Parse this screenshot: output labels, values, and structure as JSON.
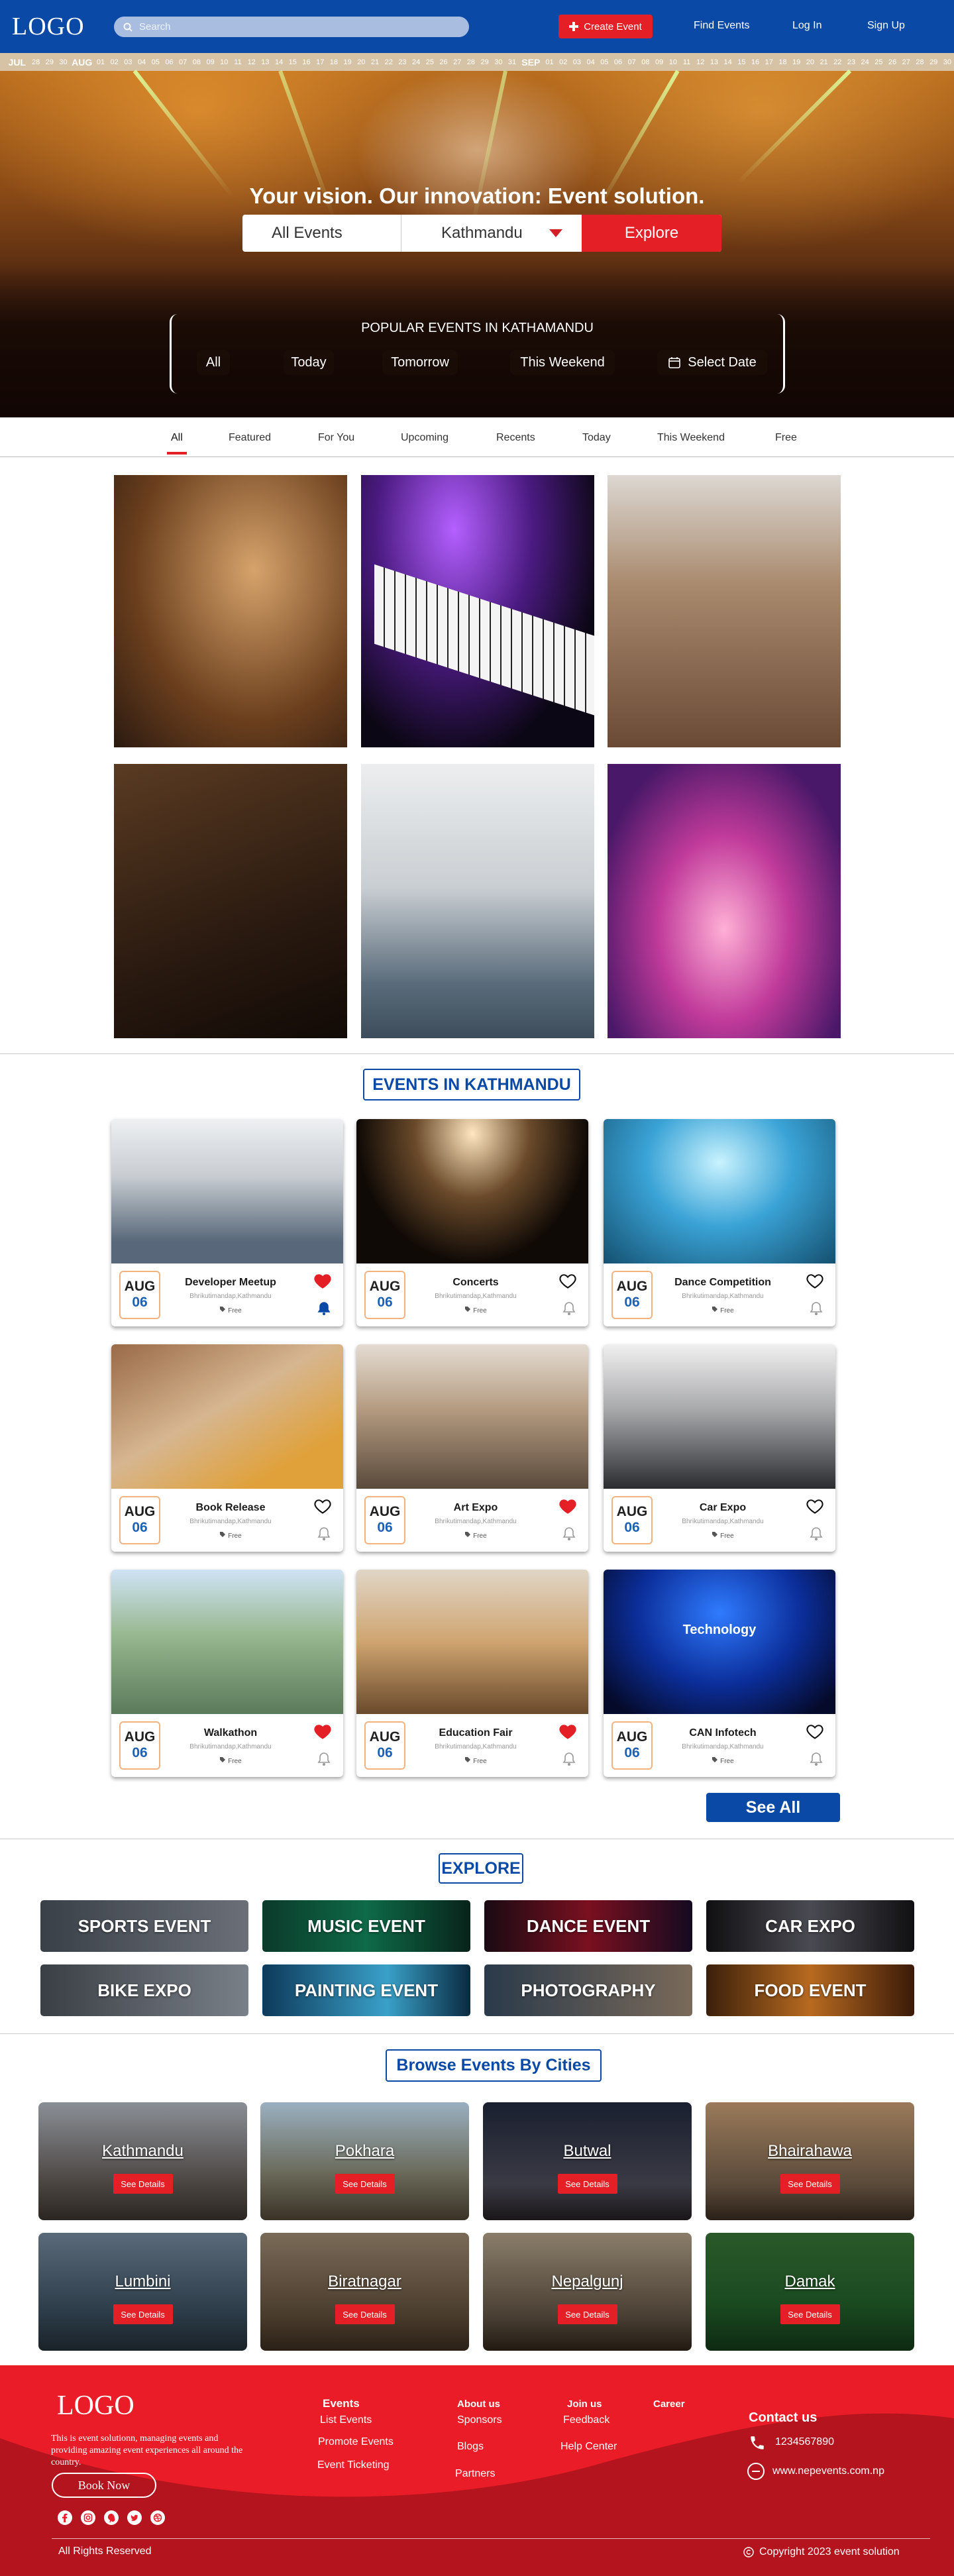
{
  "nav": {
    "logo": "LOGO",
    "search_placeholder": "Search",
    "create_event": "Create Event",
    "links": [
      "Find Events",
      "Log In",
      "Sign Up"
    ]
  },
  "date_strip": {
    "jul_label": "JUL",
    "jul_days": [
      "28",
      "29",
      "30"
    ],
    "aug_label": "AUG",
    "aug_days": [
      "01",
      "02",
      "03",
      "04",
      "05",
      "06",
      "07",
      "08",
      "09",
      "10",
      "11",
      "12",
      "13",
      "14",
      "15",
      "16",
      "17",
      "18",
      "19",
      "20",
      "21",
      "22",
      "23",
      "24",
      "25",
      "26",
      "27",
      "28",
      "29",
      "30",
      "31"
    ],
    "sep_label": "SEP",
    "sep_days": [
      "01",
      "02",
      "03",
      "04",
      "05",
      "06",
      "07",
      "08",
      "09",
      "10",
      "11",
      "12",
      "13",
      "14",
      "15",
      "16",
      "17",
      "18",
      "19",
      "20",
      "21",
      "22",
      "23",
      "24",
      "25",
      "26",
      "27",
      "28",
      "29",
      "30"
    ]
  },
  "hero": {
    "headline": "Your vision. Our innovation: Event solution.",
    "all_events": "All Events",
    "city": "Kathmandu",
    "explore": "Explore",
    "popular_title": "POPULAR EVENTS IN KATHAMANDU",
    "chips": [
      "All",
      "Today",
      "Tomorrow",
      "This Weekend",
      "Select Date"
    ]
  },
  "tabs": [
    "All",
    "Featured",
    "For You",
    "Upcoming",
    "Recents",
    "Today",
    "This Weekend",
    "Free"
  ],
  "events_section": {
    "title": "EVENTS IN KATHMANDU",
    "see_all": "See All",
    "cards": [
      {
        "name": "Developer Meetup",
        "month": "AUG",
        "day": "06",
        "location": "Bhrikutimandap,Kathmandu",
        "price": "Free",
        "liked": true,
        "notify": true
      },
      {
        "name": "Concerts",
        "month": "AUG",
        "day": "06",
        "location": "Bhrikutimandap,Kathmandu",
        "price": "Free",
        "liked": false,
        "notify": false
      },
      {
        "name": "Dance Competition",
        "month": "AUG",
        "day": "06",
        "location": "Bhrikutimandap,Kathmandu",
        "price": "Free",
        "liked": false,
        "notify": false
      },
      {
        "name": "Book Release",
        "month": "AUG",
        "day": "06",
        "location": "Bhrikutimandap,Kathmandu",
        "price": "Free",
        "liked": false,
        "notify": false
      },
      {
        "name": "Art Expo",
        "month": "AUG",
        "day": "06",
        "location": "Bhrikutimandap,Kathmandu",
        "price": "Free",
        "liked": true,
        "notify": false
      },
      {
        "name": "Car Expo",
        "month": "AUG",
        "day": "06",
        "location": "Bhrikutimandap,Kathmandu",
        "price": "Free",
        "liked": false,
        "notify": false
      },
      {
        "name": "Walkathon",
        "month": "AUG",
        "day": "06",
        "location": "Bhrikutimandap,Kathmandu",
        "price": "Free",
        "liked": true,
        "notify": false
      },
      {
        "name": "Education Fair",
        "month": "AUG",
        "day": "06",
        "location": "Bhrikutimandap,Kathmandu",
        "price": "Free",
        "liked": true,
        "notify": false
      },
      {
        "name": "CAN Infotech",
        "month": "AUG",
        "day": "06",
        "location": "Bhrikutimandap,Kathmandu",
        "price": "Free",
        "liked": false,
        "notify": false
      }
    ],
    "tech_banner": "Technology"
  },
  "explore": {
    "title": "EXPLORE",
    "tiles": [
      "SPORTS EVENT",
      "MUSIC EVENT",
      "DANCE EVENT",
      "CAR EXPO",
      "BIKE EXPO",
      "PAINTING EVENT",
      "PHOTOGRAPHY",
      "FOOD EVENT"
    ]
  },
  "cities": {
    "title": "Browse Events By Cities",
    "details_label": "See Details",
    "items": [
      "Kathmandu",
      "Pokhara",
      "Butwal",
      "Bhairahawa",
      "Lumbini",
      "Biratnagar",
      "Nepalgunj",
      "Damak"
    ]
  },
  "footer": {
    "logo": "LOGO",
    "about": "This is event solutionn, managing events and providing amazing event experiences all around the country.",
    "book_now": "Book Now",
    "events_heading": "Events",
    "events_links": [
      "List Events",
      "Promote Events",
      "Event Ticketing"
    ],
    "about_heading": "About us",
    "about_links": [
      "Sponsors",
      "Blogs",
      "Partners"
    ],
    "join_heading": "Join us",
    "join_links": [
      "Feedback",
      "Help Center"
    ],
    "career_heading": "Career",
    "contact_heading": "Contact us",
    "phone": "1234567890",
    "website": "www.nepevents.com.np",
    "rights": "All Rights Reserved",
    "copyright": "Copyright 2023 event solution"
  },
  "colors": {
    "brand_blue": "#0a4aa6",
    "accent_red": "#e41f26",
    "footer_red": "#ea1c27"
  }
}
